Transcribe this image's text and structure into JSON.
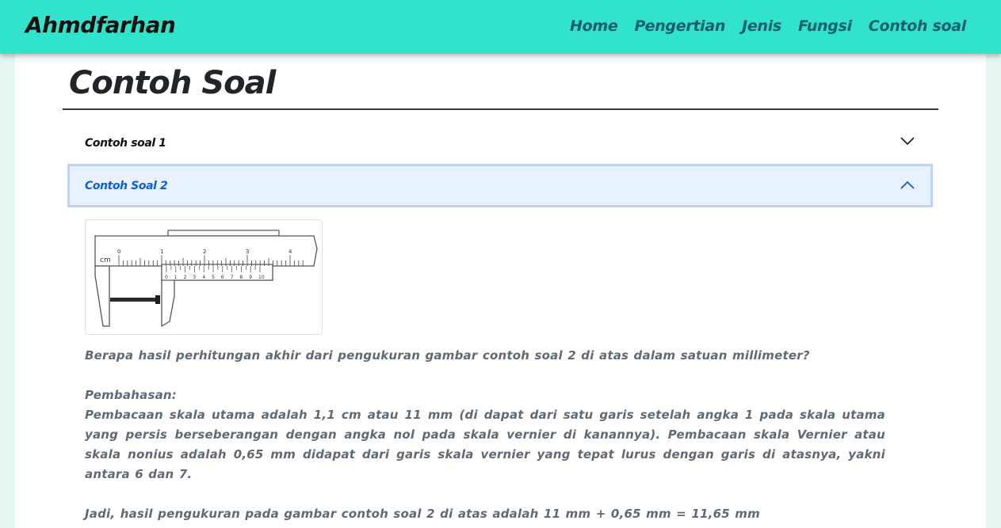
{
  "nav": {
    "brand": "Ahmdfarhan",
    "links": [
      "Home",
      "Pengertian",
      "Jenis",
      "Fungsi",
      "Contoh soal"
    ]
  },
  "page": {
    "title": "Contoh Soal"
  },
  "accordion": {
    "items": [
      {
        "label": "Contoh soal 1",
        "expanded": false
      },
      {
        "label": "Contoh Soal 2",
        "expanded": true
      }
    ]
  },
  "figure": {
    "main_unit": "cm",
    "main_ticks": [
      "0",
      "1",
      "2",
      "3",
      "4"
    ],
    "vernier_ticks": [
      "0",
      "1",
      "2",
      "3",
      "4",
      "5",
      "6",
      "7",
      "8",
      "9",
      "10"
    ]
  },
  "content": {
    "question": "Berapa hasil perhitungan akhir dari pengukuran gambar contoh soal 2 di atas dalam satuan millimeter?",
    "pembahasan_heading": "Pembahasan:",
    "pembahasan_body": "Pembacaan skala utama adalah 1,1 cm atau 11 mm (di dapat dari satu garis setelah angka 1 pada skala utama yang persis berseberangan dengan angka nol pada skala vernier di kanannya). Pembacaan skala Vernier atau skala nonius adalah 0,65 mm didapat dari garis skala vernier yang tepat lurus dengan garis di atasnya, yakni antara 6 dan 7.",
    "conclusion": "Jadi, hasil pengukuran pada gambar contoh soal 2 di atas adalah 11 mm + 0,65 mm = 11,65 mm"
  },
  "colors": {
    "navbar": "#30e3ca",
    "nav_link": "#11606a",
    "accordion_active_bg": "#e7f1ff",
    "accordion_active_text": "#0d5fd8"
  }
}
